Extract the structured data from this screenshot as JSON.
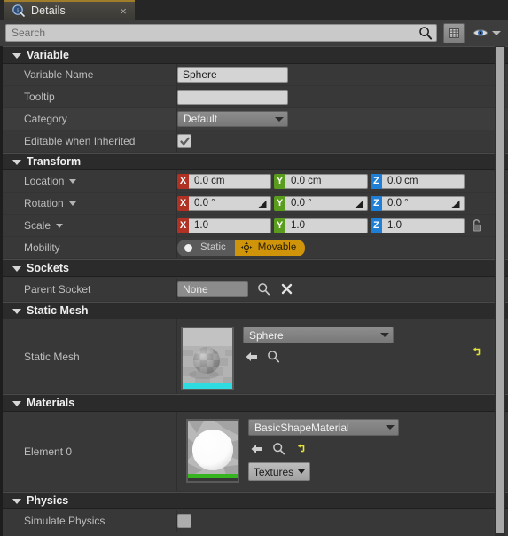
{
  "tab": {
    "title": "Details",
    "icon": "details-info-magnifier-icon",
    "close_label": "×"
  },
  "search": {
    "placeholder": "Search",
    "value": "",
    "search_icon": "magnifier-icon",
    "grid_view_icon": "column-view-icon",
    "view_options_icon": "eye-icon"
  },
  "accent_colors": {
    "tab_highlight": "#a07d2a",
    "axis_x": "#b03224",
    "axis_y": "#5a9c1d",
    "axis_z": "#1f7fd4",
    "mobility_movable": "#cf9409",
    "reset_arrow": "#e3e33a",
    "mesh_thumb_bar": "#2ddbe0",
    "material_thumb_bar": "#36b521"
  },
  "sections": {
    "variable": {
      "title": "Variable",
      "rows": {
        "variable_name": {
          "label": "Variable Name",
          "value": "Sphere"
        },
        "tooltip": {
          "label": "Tooltip",
          "value": ""
        },
        "category": {
          "label": "Category",
          "value": "Default"
        },
        "editable_when_inherited": {
          "label": "Editable when Inherited",
          "checked": true
        }
      }
    },
    "transform": {
      "title": "Transform",
      "location": {
        "label": "Location",
        "x": "0.0 cm",
        "y": "0.0 cm",
        "z": "0.0 cm"
      },
      "rotation": {
        "label": "Rotation",
        "x": "0.0 °",
        "y": "0.0 °",
        "z": "0.0 °"
      },
      "scale": {
        "label": "Scale",
        "x": "1.0",
        "y": "1.0",
        "z": "1.0",
        "lock_icon": "unlocked-padlock-icon"
      },
      "mobility": {
        "label": "Mobility",
        "static_label": "Static",
        "movable_label": "Movable",
        "selected": "Movable"
      },
      "axis_labels": {
        "x": "X",
        "y": "Y",
        "z": "Z"
      }
    },
    "sockets": {
      "title": "Sockets",
      "parent_socket": {
        "label": "Parent Socket",
        "value": "None",
        "browse_icon": "magnifier-icon",
        "clear_icon": "clear-x-icon"
      }
    },
    "static_mesh": {
      "title": "Static Mesh",
      "element": {
        "label": "Static Mesh",
        "asset_name": "Sphere",
        "thumbnail": "checkered-sphere-thumbnail",
        "back_icon": "use-selected-arrow-icon",
        "browse_icon": "browse-magnifier-icon",
        "reset_icon": "reset-to-default-icon"
      }
    },
    "materials": {
      "title": "Materials",
      "element": {
        "label": "Element 0",
        "asset_name": "BasicShapeMaterial",
        "thumbnail": "white-sphere-material-thumbnail",
        "back_icon": "use-selected-arrow-icon",
        "browse_icon": "browse-magnifier-icon",
        "reset_icon": "reset-to-default-icon",
        "textures_label": "Textures"
      }
    },
    "physics": {
      "title": "Physics",
      "simulate_physics": {
        "label": "Simulate Physics",
        "checked": false
      }
    }
  }
}
